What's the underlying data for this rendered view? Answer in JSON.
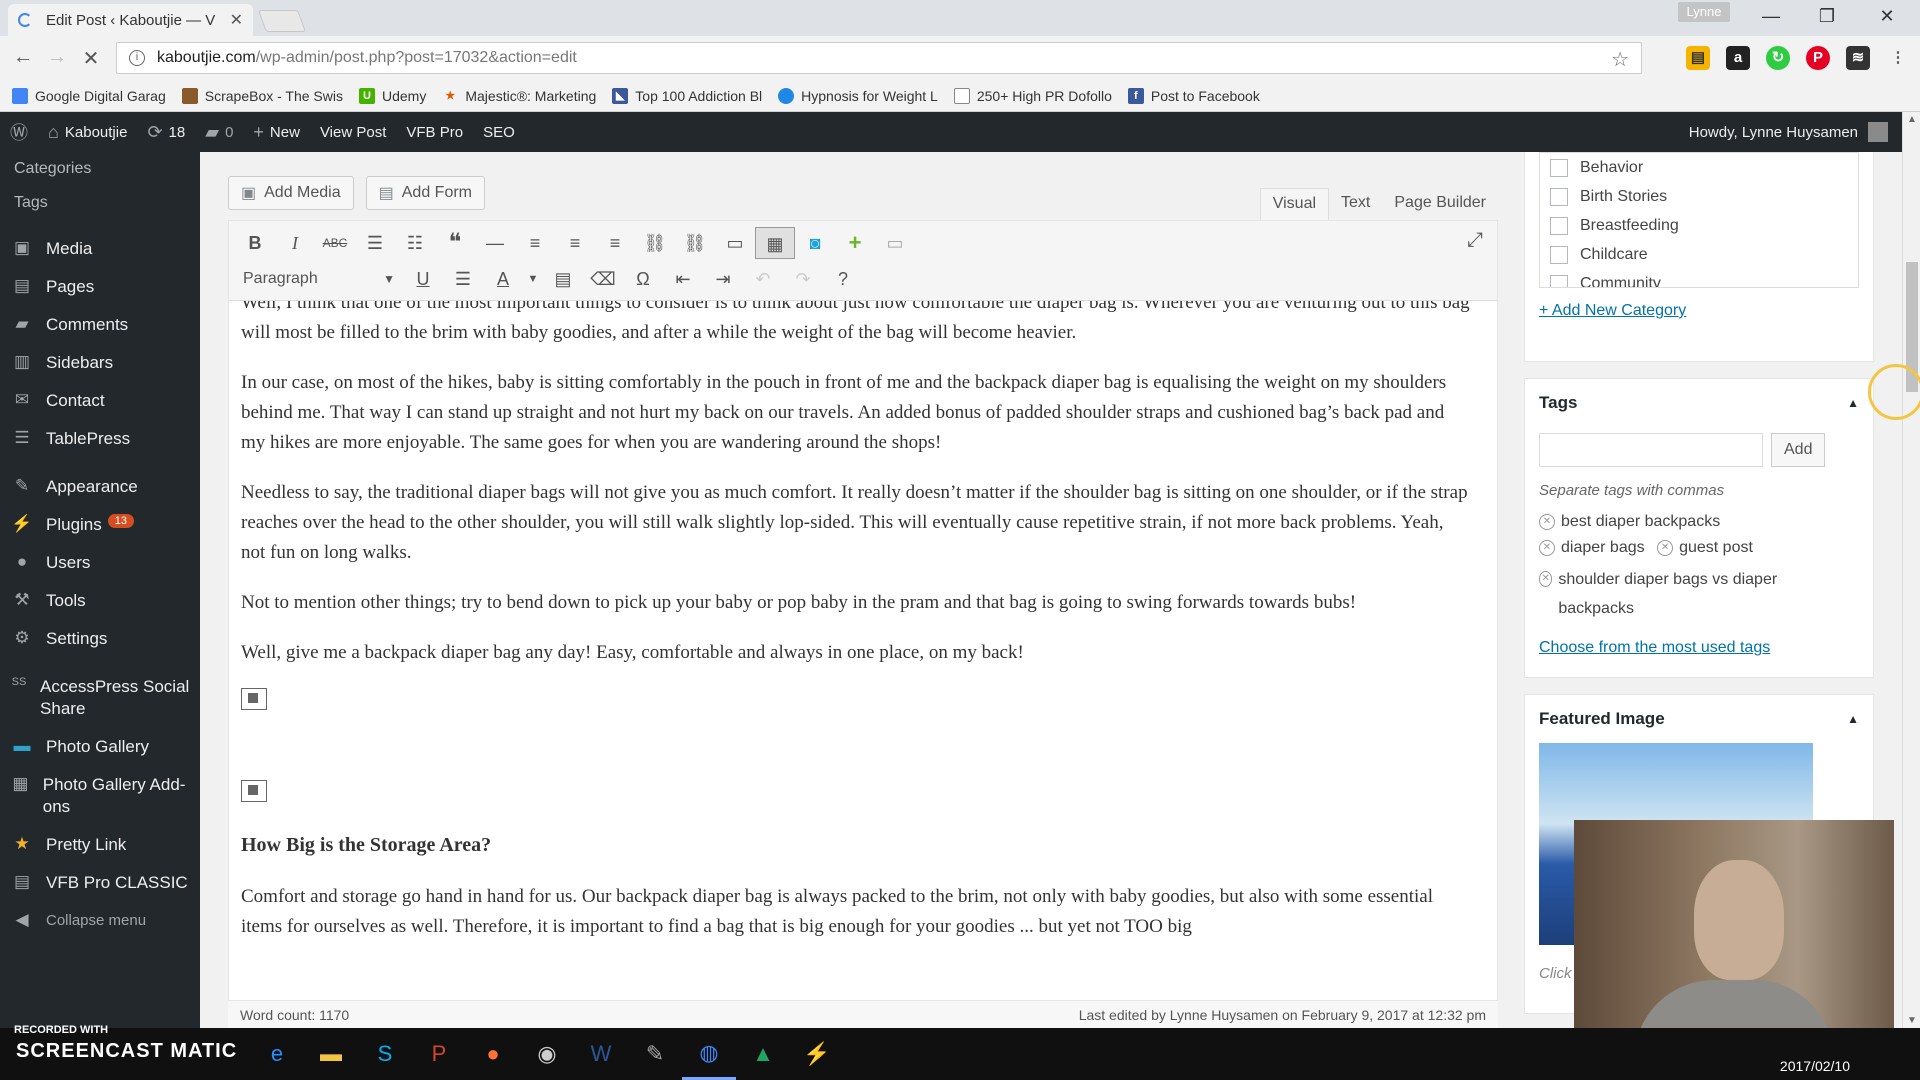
{
  "browser": {
    "tab_title": "Edit Post ‹ Kaboutjie — V",
    "profile": "Lynne",
    "url_host": "kaboutjie.com",
    "url_path": "/wp-admin/post.php?post=17032&action=edit"
  },
  "bookmarks": [
    {
      "label": "Google Digital Garag",
      "color": "#4285f4"
    },
    {
      "label": "ScrapeBox - The Swis",
      "color": "#8b5a2b"
    },
    {
      "label": "Udemy",
      "color": "#44b300"
    },
    {
      "label": "Majestic®: Marketing",
      "color": "#e05a00"
    },
    {
      "label": "Top 100 Addiction Bl",
      "color": "#3b5998"
    },
    {
      "label": "Hypnosis for Weight L",
      "color": "#1e88e5"
    },
    {
      "label": "250+ High PR Dofollo",
      "color": "#888888"
    },
    {
      "label": "Post to Facebook",
      "color": "#3b5998"
    }
  ],
  "adminbar": {
    "site": "Kaboutjie",
    "updates": "18",
    "comments": "0",
    "new": "New",
    "view_post": "View Post",
    "vfb": "VFB Pro",
    "seo": "SEO",
    "howdy": "Howdy, Lynne Huysamen"
  },
  "sidebar": {
    "sub_categories": "Categories",
    "sub_tags": "Tags",
    "media": "Media",
    "pages": "Pages",
    "comments": "Comments",
    "sidebars": "Sidebars",
    "contact": "Contact",
    "tablepress": "TablePress",
    "appearance": "Appearance",
    "plugins": "Plugins",
    "plugins_badge": "13",
    "users": "Users",
    "tools": "Tools",
    "settings": "Settings",
    "accesspress": "AccessPress Social Share",
    "photo_gallery": "Photo Gallery",
    "photo_gallery_addons": "Photo Gallery Add-ons",
    "pretty_link": "Pretty Link",
    "vfb_classic": "VFB Pro CLASSIC",
    "collapse": "Collapse menu"
  },
  "editor": {
    "add_media": "Add Media",
    "add_form": "Add Form",
    "tab_visual": "Visual",
    "tab_text": "Text",
    "tab_page_builder": "Page Builder",
    "format_select": "Paragraph",
    "p_clip": "Well, I think that one of the most important things to consider is to think about just how comfortable the diaper bag is.  Wherever you are venturing out to this bag will most be filled to the brim with baby goodies, and after a while the weight of the bag will become heavier.",
    "p1": "In our case, on most of the hikes, baby is sitting comfortably in the pouch in front of me and the backpack diaper bag is equalising the weight on my shoulders behind me.  That way I can stand up straight and not hurt my back on our travels.  An added bonus of padded shoulder straps and cushioned bag’s back pad and my hikes are more enjoyable.  The same goes for when you are wandering around the shops!",
    "p2": "Needless to say, the traditional diaper bags will not give you as much comfort. It really doesn’t matter if the shoulder bag is sitting on one shoulder, or if the strap reaches over the head to the other shoulder, you will still walk slightly lop-sided.  This will eventually cause repetitive strain, if not more back problems.  Yeah, not fun on long walks.",
    "p3": "Not to mention other things; try to bend down to pick up your baby or pop baby in the pram and that bag is going to swing forwards towards bubs!",
    "p4": "Well, give me a backpack diaper bag any day!  Easy, comfortable and always in one place, on my back!",
    "h3": "How Big is the Storage Area?",
    "p5": "Comfort and storage go hand in hand for us.  Our backpack diaper bag is always packed to the brim, not only with baby goodies, but also with some essential items for ourselves as well.  Therefore, it is important to find a bag that is big enough for your goodies ... but yet not TOO big",
    "path": "p",
    "word_count": "Word count: 1170",
    "last_edited": "Last edited by Lynne Huysamen on February 9, 2017 at 12:32 pm"
  },
  "categories": {
    "items": [
      "Behavior",
      "Birth Stories",
      "Breastfeeding",
      "Childcare",
      "Community"
    ],
    "add_new": "+ Add New Category"
  },
  "tags": {
    "title": "Tags",
    "add": "Add",
    "hint": "Separate tags with commas",
    "tag1": "best diaper backpacks",
    "tag2": "diaper bags",
    "tag3": "guest post",
    "tag4": "shoulder diaper bags vs diaper backpacks",
    "choose": "Choose from the most used tags"
  },
  "featured": {
    "title": "Featured Image",
    "click": "Click"
  },
  "taskbar": {
    "recorded": "RECORDED WITH",
    "logo": "SCREENCAST MATIC",
    "date": "2017/02/10"
  },
  "colors": {
    "admin_dark": "#23282d",
    "link": "#0073aa",
    "badge": "#d54e21"
  }
}
